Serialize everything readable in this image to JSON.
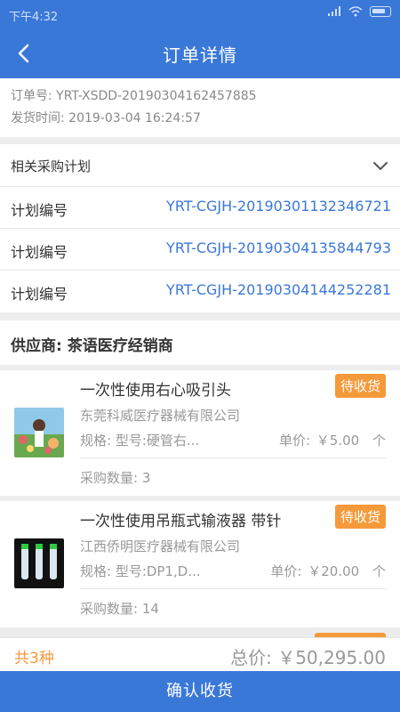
{
  "status_bar": {
    "time": "下午4:32",
    "signal": "📶",
    "wifi": "WiFi"
  },
  "nav": {
    "title": "订单详情"
  },
  "order": {
    "number_label": "订单号: YRT-XSDD-20190304162457885",
    "ship_time_label": "发货时间: 2019-03-04 16:24:57"
  },
  "plans": {
    "header": "相关采购计划",
    "rows": [
      {
        "key": "计划编号",
        "value": "YRT-CGJH-20190301132346721"
      },
      {
        "key": "计划编号",
        "value": "YRT-CGJH-20190304135844793"
      },
      {
        "key": "计划编号",
        "value": "YRT-CGJH-20190304144252281"
      }
    ]
  },
  "supplier": {
    "label": "供应商: 茶语医疗经销商"
  },
  "products": [
    {
      "name": "一次性使用右心吸引头",
      "status": "待收货",
      "company": "东莞科威医疗器械有限公司",
      "spec": "规格: 型号:硬管右...",
      "price_label": "单价:",
      "price": "￥5.00",
      "unit": "个",
      "qty": "采购数量: 3"
    },
    {
      "name": "一次性使用吊瓶式输液器 带针",
      "status": "待收货",
      "company": "江西侨明医疗器械有限公司",
      "spec": "规格: 型号:DP1,D...",
      "price_label": "单价:",
      "price": "￥20.00",
      "unit": "个",
      "qty": "采购数量: 14"
    }
  ],
  "summary": {
    "count": "共3种",
    "total": "总价: ￥50,295.00"
  },
  "confirm_button": "确认收货",
  "colors": {
    "primary": "#3a78d8",
    "accent": "#f59a3b"
  }
}
